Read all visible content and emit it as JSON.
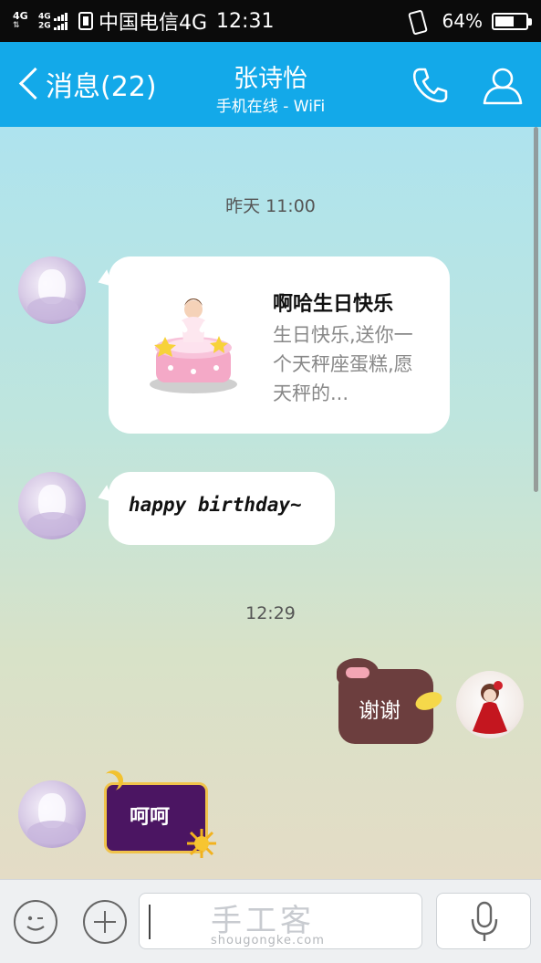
{
  "status_bar": {
    "network_1": "4G",
    "network_2a": "4G",
    "network_2b": "2G",
    "carrier": "中国电信4G",
    "time": "12:31",
    "battery_percent": "64%",
    "battery_level": 0.64
  },
  "header": {
    "back_label": "消息(22)",
    "contact_name": "张诗怡",
    "contact_status": "手机在线 - WiFi"
  },
  "chat": {
    "timestamp_1": "昨天 11:00",
    "gift_card": {
      "title": "啊哈生日快乐",
      "description": "生日快乐,送你一个天秤座蛋糕,愿天秤的..."
    },
    "message_2": "happy birthday~",
    "timestamp_2": "12:29",
    "message_3": "谢谢",
    "message_4": "呵呵"
  },
  "input_bar": {
    "text_value": "",
    "watermark": "手工客",
    "watermark_url": "shougongke.com"
  },
  "colors": {
    "header_bg": "#13a9e9",
    "status_bg": "#0b0b0b",
    "bubble_bg": "#ffffff"
  }
}
